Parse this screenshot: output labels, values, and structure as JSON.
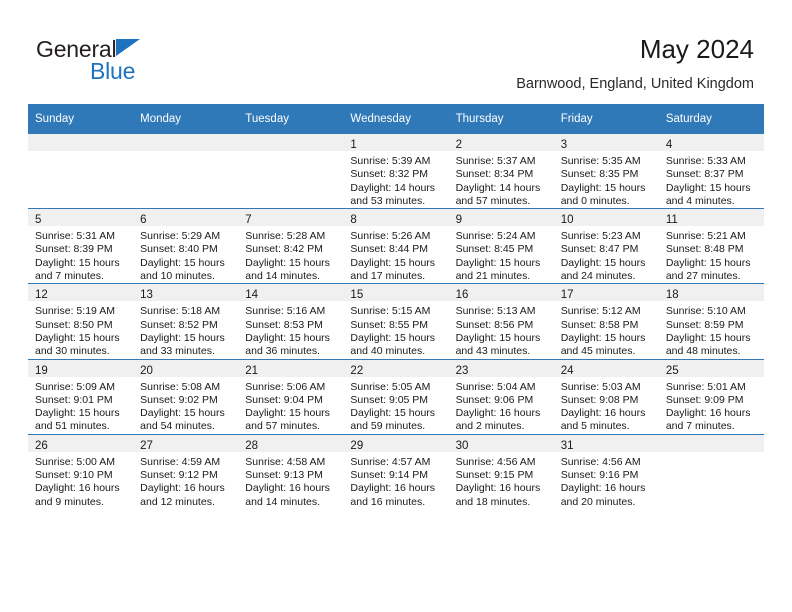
{
  "brand": {
    "name_part1": "General",
    "name_part2": "Blue",
    "accent_color": "#1e73be",
    "triangle_icon": "triangle-icon"
  },
  "header": {
    "title": "May 2024",
    "subtitle": "Barnwood, England, United Kingdom",
    "header_bg_color": "#3079b8"
  },
  "calendar": {
    "weekday_headers": [
      "Sunday",
      "Monday",
      "Tuesday",
      "Wednesday",
      "Thursday",
      "Friday",
      "Saturday"
    ],
    "weeks": [
      [
        {
          "day": "",
          "sunrise": "",
          "sunset": "",
          "daylight_line1": "",
          "daylight_line2": ""
        },
        {
          "day": "",
          "sunrise": "",
          "sunset": "",
          "daylight_line1": "",
          "daylight_line2": ""
        },
        {
          "day": "",
          "sunrise": "",
          "sunset": "",
          "daylight_line1": "",
          "daylight_line2": ""
        },
        {
          "day": "1",
          "sunrise": "Sunrise: 5:39 AM",
          "sunset": "Sunset: 8:32 PM",
          "daylight_line1": "Daylight: 14 hours",
          "daylight_line2": "and 53 minutes."
        },
        {
          "day": "2",
          "sunrise": "Sunrise: 5:37 AM",
          "sunset": "Sunset: 8:34 PM",
          "daylight_line1": "Daylight: 14 hours",
          "daylight_line2": "and 57 minutes."
        },
        {
          "day": "3",
          "sunrise": "Sunrise: 5:35 AM",
          "sunset": "Sunset: 8:35 PM",
          "daylight_line1": "Daylight: 15 hours",
          "daylight_line2": "and 0 minutes."
        },
        {
          "day": "4",
          "sunrise": "Sunrise: 5:33 AM",
          "sunset": "Sunset: 8:37 PM",
          "daylight_line1": "Daylight: 15 hours",
          "daylight_line2": "and 4 minutes."
        }
      ],
      [
        {
          "day": "5",
          "sunrise": "Sunrise: 5:31 AM",
          "sunset": "Sunset: 8:39 PM",
          "daylight_line1": "Daylight: 15 hours",
          "daylight_line2": "and 7 minutes."
        },
        {
          "day": "6",
          "sunrise": "Sunrise: 5:29 AM",
          "sunset": "Sunset: 8:40 PM",
          "daylight_line1": "Daylight: 15 hours",
          "daylight_line2": "and 10 minutes."
        },
        {
          "day": "7",
          "sunrise": "Sunrise: 5:28 AM",
          "sunset": "Sunset: 8:42 PM",
          "daylight_line1": "Daylight: 15 hours",
          "daylight_line2": "and 14 minutes."
        },
        {
          "day": "8",
          "sunrise": "Sunrise: 5:26 AM",
          "sunset": "Sunset: 8:44 PM",
          "daylight_line1": "Daylight: 15 hours",
          "daylight_line2": "and 17 minutes."
        },
        {
          "day": "9",
          "sunrise": "Sunrise: 5:24 AM",
          "sunset": "Sunset: 8:45 PM",
          "daylight_line1": "Daylight: 15 hours",
          "daylight_line2": "and 21 minutes."
        },
        {
          "day": "10",
          "sunrise": "Sunrise: 5:23 AM",
          "sunset": "Sunset: 8:47 PM",
          "daylight_line1": "Daylight: 15 hours",
          "daylight_line2": "and 24 minutes."
        },
        {
          "day": "11",
          "sunrise": "Sunrise: 5:21 AM",
          "sunset": "Sunset: 8:48 PM",
          "daylight_line1": "Daylight: 15 hours",
          "daylight_line2": "and 27 minutes."
        }
      ],
      [
        {
          "day": "12",
          "sunrise": "Sunrise: 5:19 AM",
          "sunset": "Sunset: 8:50 PM",
          "daylight_line1": "Daylight: 15 hours",
          "daylight_line2": "and 30 minutes."
        },
        {
          "day": "13",
          "sunrise": "Sunrise: 5:18 AM",
          "sunset": "Sunset: 8:52 PM",
          "daylight_line1": "Daylight: 15 hours",
          "daylight_line2": "and 33 minutes."
        },
        {
          "day": "14",
          "sunrise": "Sunrise: 5:16 AM",
          "sunset": "Sunset: 8:53 PM",
          "daylight_line1": "Daylight: 15 hours",
          "daylight_line2": "and 36 minutes."
        },
        {
          "day": "15",
          "sunrise": "Sunrise: 5:15 AM",
          "sunset": "Sunset: 8:55 PM",
          "daylight_line1": "Daylight: 15 hours",
          "daylight_line2": "and 40 minutes."
        },
        {
          "day": "16",
          "sunrise": "Sunrise: 5:13 AM",
          "sunset": "Sunset: 8:56 PM",
          "daylight_line1": "Daylight: 15 hours",
          "daylight_line2": "and 43 minutes."
        },
        {
          "day": "17",
          "sunrise": "Sunrise: 5:12 AM",
          "sunset": "Sunset: 8:58 PM",
          "daylight_line1": "Daylight: 15 hours",
          "daylight_line2": "and 45 minutes."
        },
        {
          "day": "18",
          "sunrise": "Sunrise: 5:10 AM",
          "sunset": "Sunset: 8:59 PM",
          "daylight_line1": "Daylight: 15 hours",
          "daylight_line2": "and 48 minutes."
        }
      ],
      [
        {
          "day": "19",
          "sunrise": "Sunrise: 5:09 AM",
          "sunset": "Sunset: 9:01 PM",
          "daylight_line1": "Daylight: 15 hours",
          "daylight_line2": "and 51 minutes."
        },
        {
          "day": "20",
          "sunrise": "Sunrise: 5:08 AM",
          "sunset": "Sunset: 9:02 PM",
          "daylight_line1": "Daylight: 15 hours",
          "daylight_line2": "and 54 minutes."
        },
        {
          "day": "21",
          "sunrise": "Sunrise: 5:06 AM",
          "sunset": "Sunset: 9:04 PM",
          "daylight_line1": "Daylight: 15 hours",
          "daylight_line2": "and 57 minutes."
        },
        {
          "day": "22",
          "sunrise": "Sunrise: 5:05 AM",
          "sunset": "Sunset: 9:05 PM",
          "daylight_line1": "Daylight: 15 hours",
          "daylight_line2": "and 59 minutes."
        },
        {
          "day": "23",
          "sunrise": "Sunrise: 5:04 AM",
          "sunset": "Sunset: 9:06 PM",
          "daylight_line1": "Daylight: 16 hours",
          "daylight_line2": "and 2 minutes."
        },
        {
          "day": "24",
          "sunrise": "Sunrise: 5:03 AM",
          "sunset": "Sunset: 9:08 PM",
          "daylight_line1": "Daylight: 16 hours",
          "daylight_line2": "and 5 minutes."
        },
        {
          "day": "25",
          "sunrise": "Sunrise: 5:01 AM",
          "sunset": "Sunset: 9:09 PM",
          "daylight_line1": "Daylight: 16 hours",
          "daylight_line2": "and 7 minutes."
        }
      ],
      [
        {
          "day": "26",
          "sunrise": "Sunrise: 5:00 AM",
          "sunset": "Sunset: 9:10 PM",
          "daylight_line1": "Daylight: 16 hours",
          "daylight_line2": "and 9 minutes."
        },
        {
          "day": "27",
          "sunrise": "Sunrise: 4:59 AM",
          "sunset": "Sunset: 9:12 PM",
          "daylight_line1": "Daylight: 16 hours",
          "daylight_line2": "and 12 minutes."
        },
        {
          "day": "28",
          "sunrise": "Sunrise: 4:58 AM",
          "sunset": "Sunset: 9:13 PM",
          "daylight_line1": "Daylight: 16 hours",
          "daylight_line2": "and 14 minutes."
        },
        {
          "day": "29",
          "sunrise": "Sunrise: 4:57 AM",
          "sunset": "Sunset: 9:14 PM",
          "daylight_line1": "Daylight: 16 hours",
          "daylight_line2": "and 16 minutes."
        },
        {
          "day": "30",
          "sunrise": "Sunrise: 4:56 AM",
          "sunset": "Sunset: 9:15 PM",
          "daylight_line1": "Daylight: 16 hours",
          "daylight_line2": "and 18 minutes."
        },
        {
          "day": "31",
          "sunrise": "Sunrise: 4:56 AM",
          "sunset": "Sunset: 9:16 PM",
          "daylight_line1": "Daylight: 16 hours",
          "daylight_line2": "and 20 minutes."
        },
        {
          "day": "",
          "sunrise": "",
          "sunset": "",
          "daylight_line1": "",
          "daylight_line2": ""
        }
      ]
    ]
  }
}
